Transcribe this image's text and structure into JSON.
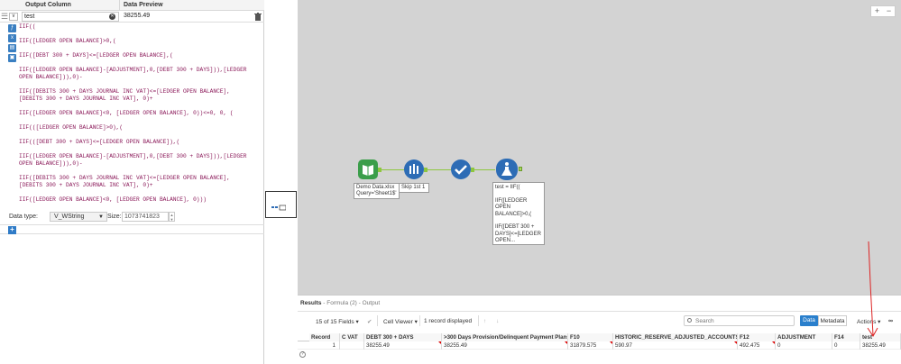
{
  "formula_panel": {
    "header": {
      "output_column": "Output Column",
      "data_preview": "Data Preview"
    },
    "field_name": "test",
    "preview_value": "38255.49",
    "tools": [
      "function-icon",
      "variable-icon",
      "field-icon",
      "save-icon"
    ],
    "code_lines": [
      "IIF((",
      "",
      "IIF([LEDGER OPEN BALANCE]>0,(",
      "",
      "IIF([DEBT 300 + DAYS]<=[LEDGER OPEN BALANCE],(",
      "",
      "IIF([LEDGER OPEN BALANCE]-[ADJUSTMENT],0,[DEBT 300 + DAYS])),[LEDGER",
      "OPEN BALANCE])),0)-",
      "",
      "IIF([DEBITS 300 + DAYS JOURNAL INC VAT]<=[LEDGER OPEN BALANCE],",
      "[DEBITS 300 + DAYS JOURNAL INC VAT], 0)+",
      "",
      "IIF([LEDGER OPEN BALANCE]<0, [LEDGER OPEN BALANCE], 0))<=0, 0, (",
      "",
      "IIF(([LEDGER OPEN BALANCE]>0),(",
      "",
      "IIF(([DEBT 300 + DAYS]<=[LEDGER OPEN BALANCE]),(",
      "",
      "IIF([LEDGER OPEN BALANCE]-[ADJUSTMENT],0,[DEBT 300 + DAYS])),[LEDGER",
      "OPEN BALANCE])),0)-",
      "",
      "IIF([DEBITS 300 + DAYS JOURNAL INC VAT]<=[LEDGER OPEN BALANCE],",
      "[DEBITS 300 + DAYS JOURNAL INC VAT], 0)+",
      "",
      "IIF([LEDGER OPEN BALANCE]<0, [LEDGER OPEN BALANCE], 0)))"
    ],
    "data_type_label": "Data type:",
    "data_type_value": "V_WString",
    "size_label": "Size:",
    "size_value": "1073741823",
    "add_label": "+"
  },
  "canvas": {
    "zoom_plus": "+",
    "zoom_minus": "−",
    "nodes": [
      {
        "name": "input-data-tool",
        "icon": "book-icon",
        "color": "#3b9e4a"
      },
      {
        "name": "sample-tool",
        "icon": "sample-icon",
        "color": "#2d6cb5"
      },
      {
        "name": "select-tool",
        "icon": "check-icon",
        "color": "#2d6cb5"
      },
      {
        "name": "formula-tool",
        "icon": "flask-icon",
        "color": "#2d6cb5"
      }
    ],
    "input_label": [
      "Demo Data.xlsx",
      "Query='Sheet1$'"
    ],
    "sample_label": "Skip 1st 1",
    "formula_annotation": [
      "test = IIF((",
      "",
      "IIF([LEDGER OPEN",
      "BALANCE]>0,(",
      "",
      "IIF([DEBT 300 +",
      "DAYS]<=[LEDGER",
      "OPEN..."
    ]
  },
  "results": {
    "title_bold": "Results",
    "title_sub": " - Formula (2) - Output",
    "fields_count": "15 of 15 Fields",
    "cell_viewer": "Cell Viewer",
    "records_displayed": "1 record displayed",
    "search_placeholder": "Search",
    "data_tab": "Data",
    "metadata_tab": "Metadata",
    "actions": "Actions",
    "more": "∞",
    "columns": [
      "Record",
      "C VAT",
      "DEBT 300 + DAYS",
      ">300 Days Provision/Delinquent Payment Plans",
      "F10",
      "HISTORIC_RESERVE_ADJUSTED_ACCOUNTS_RE...",
      "F12",
      "ADJUSTMENT",
      "F14",
      "test"
    ],
    "row": [
      "1",
      "",
      "38255.49",
      "38255.49",
      "31879.575",
      "590.97",
      "492.475",
      "0",
      "0",
      "38255.49"
    ]
  }
}
